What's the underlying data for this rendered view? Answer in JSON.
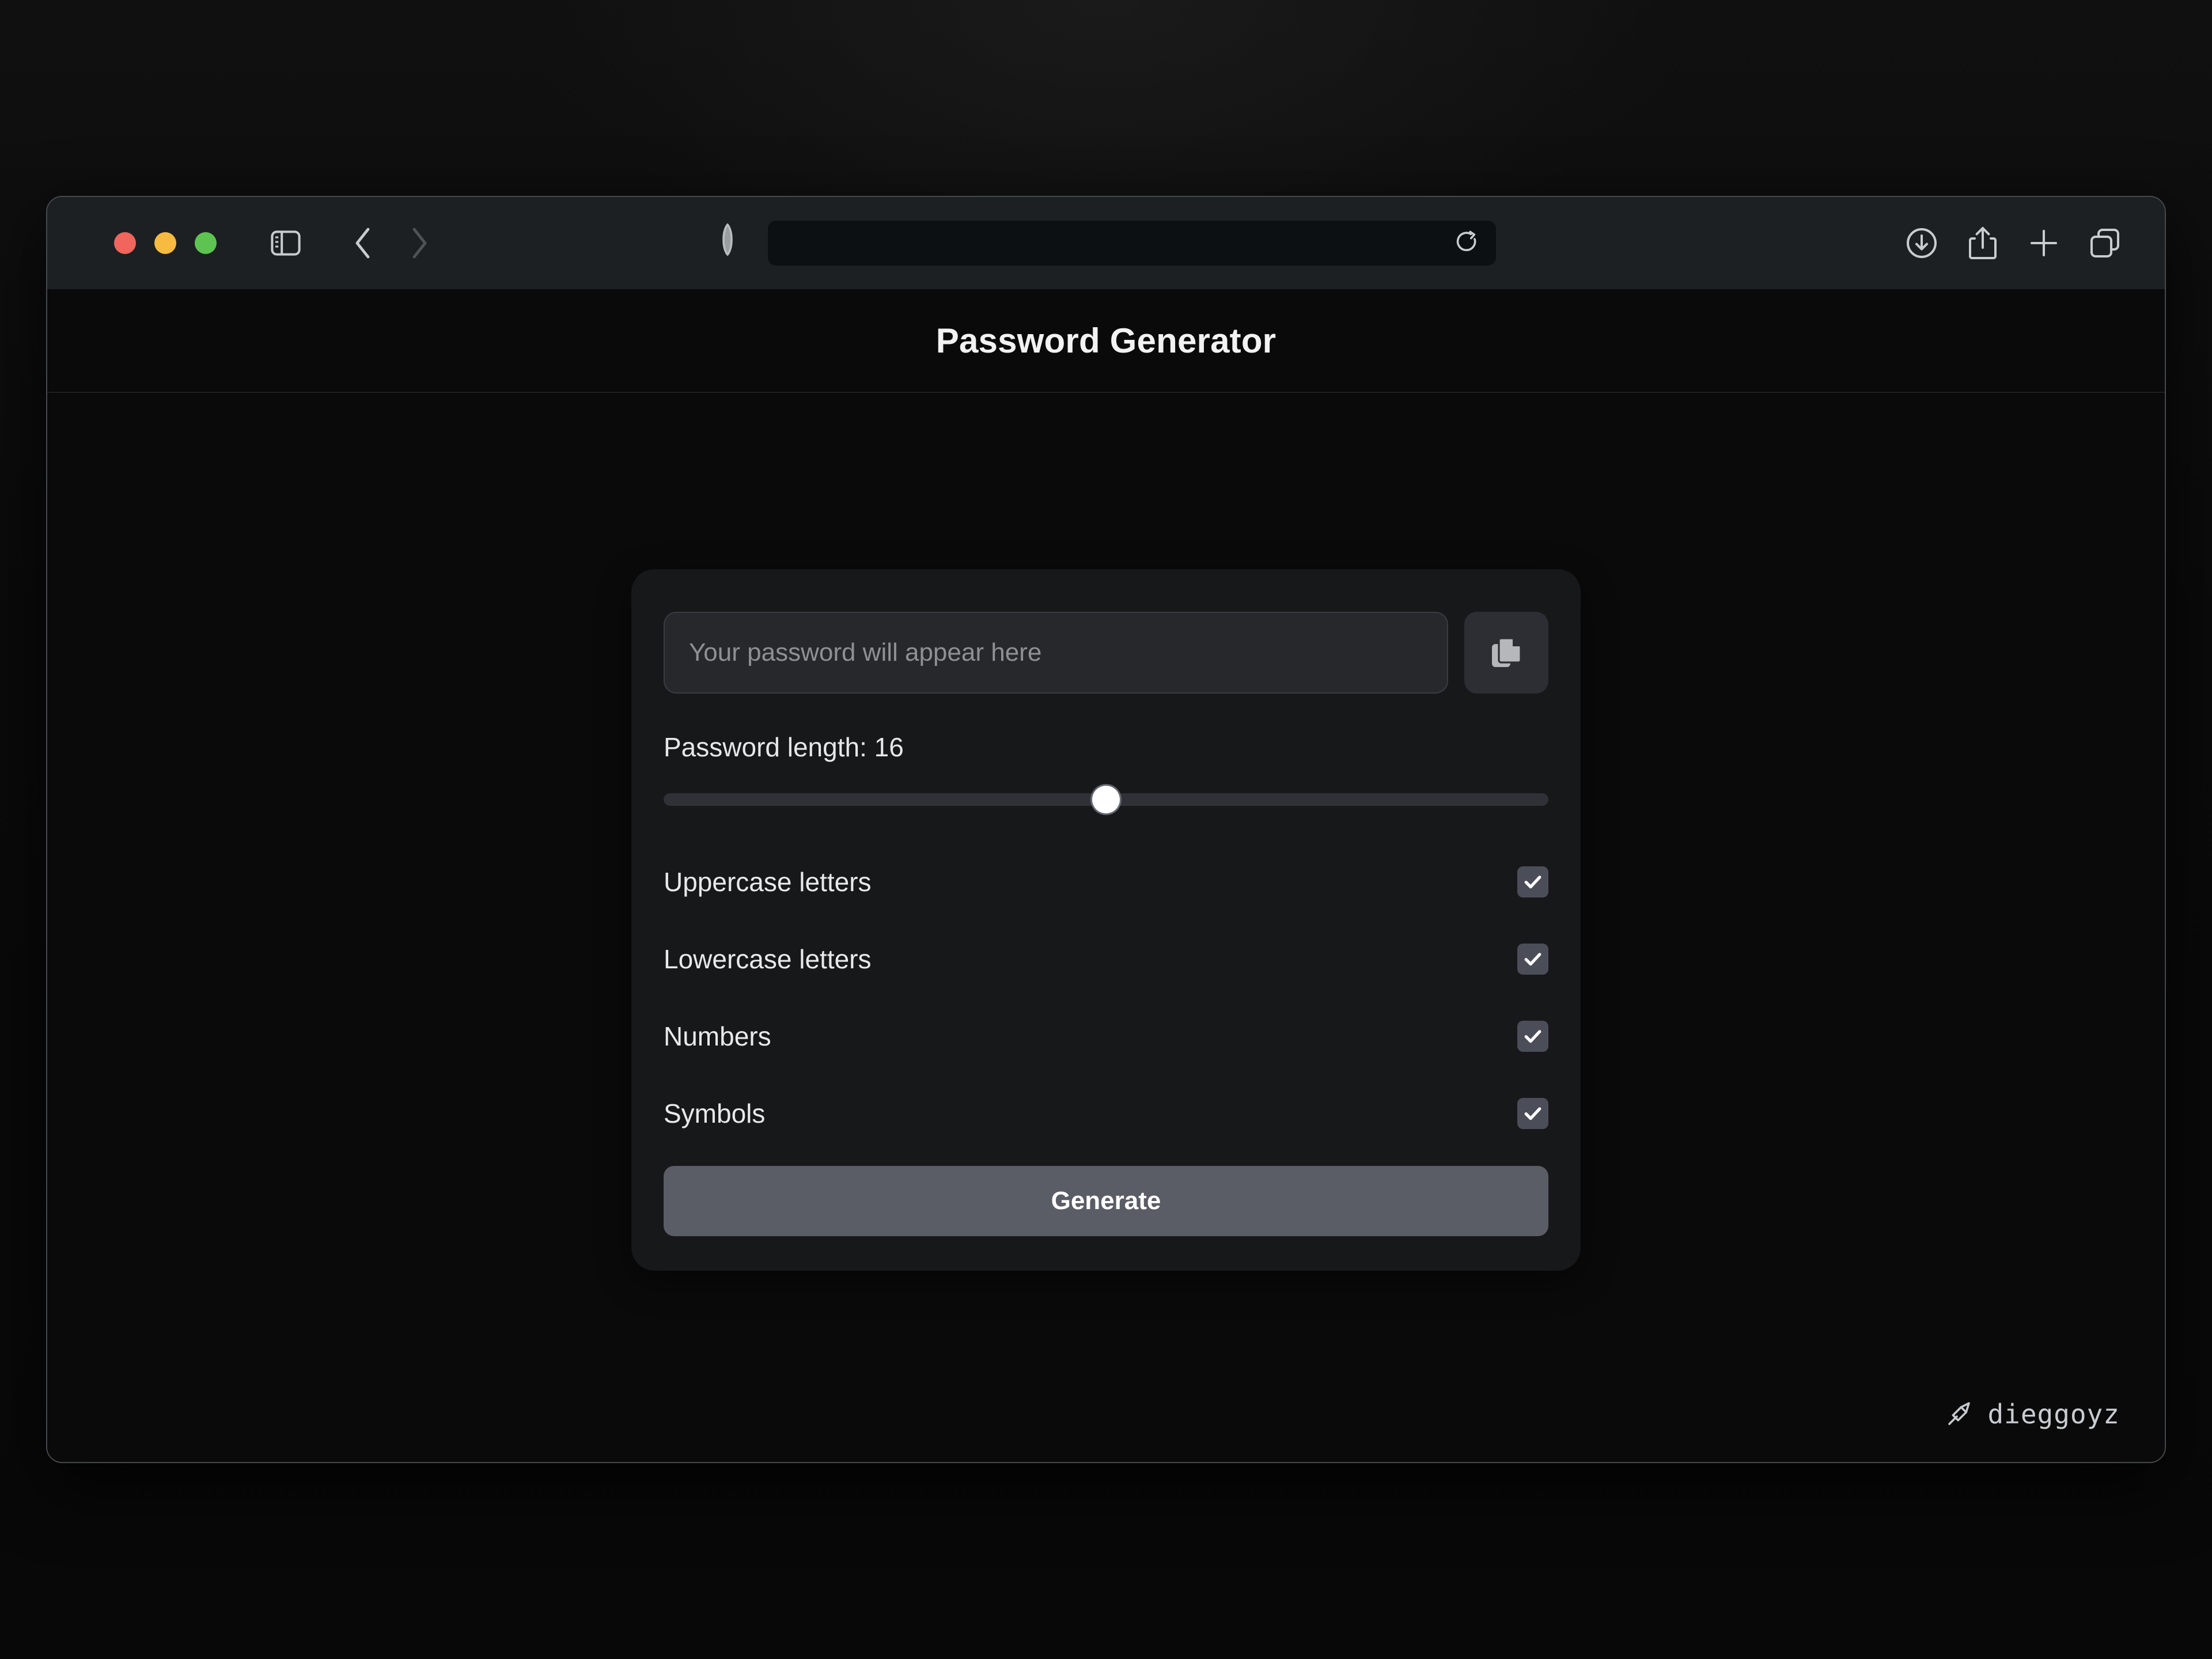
{
  "window": {
    "traffic_lights": [
      {
        "name": "close",
        "color": "#f0655c"
      },
      {
        "name": "minimize",
        "color": "#f6bb40"
      },
      {
        "name": "zoom",
        "color": "#5ec451"
      }
    ]
  },
  "toolbar": {
    "sidebar_icon": "sidebar-icon",
    "back_icon": "chevron-left-icon",
    "forward_icon": "chevron-right-icon",
    "shield_icon": "shield-icon",
    "address": {
      "value": "",
      "placeholder": ""
    },
    "reload_icon": "reload-icon",
    "downloads_icon": "downloads-icon",
    "share_icon": "share-icon",
    "new_tab_icon": "plus-icon",
    "tab_overview_icon": "tab-overview-icon"
  },
  "header": {
    "title": "Password Generator"
  },
  "card": {
    "password_field": {
      "value": "",
      "placeholder": "Your password will appear here"
    },
    "copy_icon": "copy-icon",
    "length": {
      "label": "Password length: 16",
      "value": 16,
      "min": 4,
      "max": 28,
      "percent": 50
    },
    "options": [
      {
        "label": "Uppercase letters",
        "checked": true,
        "check_glyph": "✓"
      },
      {
        "label": "Lowercase letters",
        "checked": true,
        "check_glyph": "✓"
      },
      {
        "label": "Numbers",
        "checked": true,
        "check_glyph": "✓"
      },
      {
        "label": "Symbols",
        "checked": true,
        "check_glyph": "✓"
      }
    ],
    "generate_label": "Generate"
  },
  "watermark": {
    "icon": "pen-nib-icon",
    "name": "dieggoyz"
  },
  "colors": {
    "page_background": "#0a0a0b",
    "toolbar": "#1c2023",
    "card": "#17181a",
    "input": "#27282c",
    "checkbox": "#4b4e58",
    "generate_button": "#5a5c66",
    "accent_text": "#ffffff"
  }
}
